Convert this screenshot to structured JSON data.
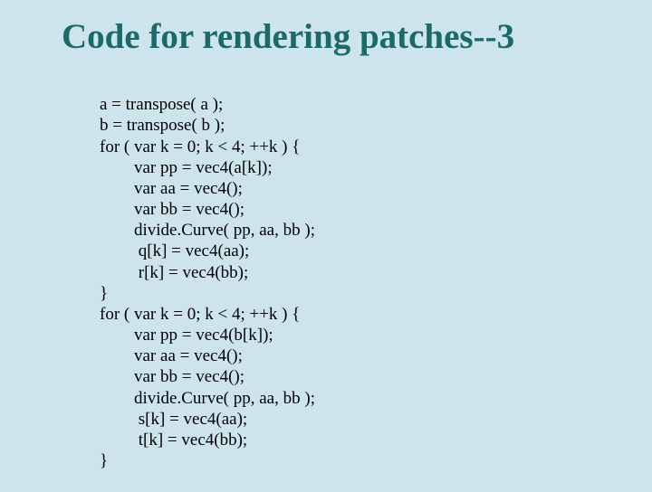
{
  "title": "Code for rendering patches--3",
  "code": {
    "l01": "a = transpose( a );",
    "l02": "b = transpose( b );",
    "l03": "for ( var k = 0; k < 4; ++k ) {",
    "l04": "        var pp = vec4(a[k]);",
    "l05": "        var aa = vec4();",
    "l06": "        var bb = vec4();",
    "l07": "        divide.Curve( pp, aa, bb );",
    "l08": "         q[k] = vec4(aa);",
    "l09": "         r[k] = vec4(bb);",
    "l10": "}",
    "l11": "for ( var k = 0; k < 4; ++k ) {",
    "l12": "        var pp = vec4(b[k]);",
    "l13": "        var aa = vec4();",
    "l14": "        var bb = vec4();",
    "l15": "        divide.Curve( pp, aa, bb );",
    "l16": "         s[k] = vec4(aa);",
    "l17": "         t[k] = vec4(bb);",
    "l18": "}"
  }
}
